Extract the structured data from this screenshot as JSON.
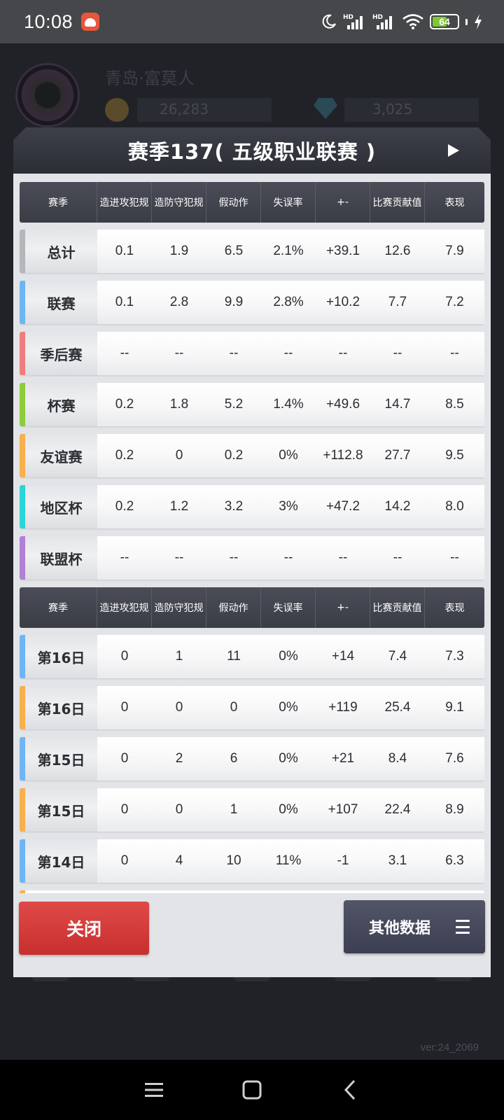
{
  "status_bar": {
    "time": "10:08",
    "battery": "64",
    "battery_level": 0.64,
    "icons": [
      "app-notification-icon",
      "moon-icon",
      "signal-hd-icon",
      "signal-hd-icon",
      "wifi-icon",
      "battery-icon",
      "charging-icon"
    ]
  },
  "background": {
    "username": "青岛·富莫人",
    "coins": "26,283",
    "gems": "3,025",
    "nav_labels": [
      "",
      "",
      "",
      "",
      ""
    ]
  },
  "modal": {
    "title": "赛季137( 五级职业联赛 )",
    "columns": [
      "赛季",
      "造进攻犯规",
      "造防守犯规",
      "假动作",
      "失误率",
      "+-",
      "比赛贡献值",
      "表现"
    ],
    "season_rows": [
      {
        "label": "总计",
        "accent": "#b5b6b9",
        "values": [
          "0.1",
          "1.9",
          "6.5",
          "2.1%",
          "+39.1",
          "12.6",
          "7.9"
        ]
      },
      {
        "label": "联赛",
        "accent": "#6fb4f5",
        "values": [
          "0.1",
          "2.8",
          "9.9",
          "2.8%",
          "+10.2",
          "7.7",
          "7.2"
        ]
      },
      {
        "label": "季后赛",
        "accent": "#f07d7d",
        "values": [
          "--",
          "--",
          "--",
          "--",
          "--",
          "--",
          "--"
        ]
      },
      {
        "label": "杯赛",
        "accent": "#8dcc3b",
        "values": [
          "0.2",
          "1.8",
          "5.2",
          "1.4%",
          "+49.6",
          "14.7",
          "8.5"
        ]
      },
      {
        "label": "友谊赛",
        "accent": "#f7b04e",
        "values": [
          "0.2",
          "0",
          "0.2",
          "0%",
          "+112.8",
          "27.7",
          "9.5"
        ]
      },
      {
        "label": "地区杯",
        "accent": "#2ad4d8",
        "values": [
          "0.2",
          "1.2",
          "3.2",
          "3%",
          "+47.2",
          "14.2",
          "8.0"
        ]
      },
      {
        "label": "联盟杯",
        "accent": "#b07fd6",
        "values": [
          "--",
          "--",
          "--",
          "--",
          "--",
          "--",
          "--"
        ]
      }
    ],
    "game_rows": [
      {
        "label": "第16日",
        "accent": "#6fb4f5",
        "values": [
          "0",
          "1",
          "11",
          "0%",
          "+14",
          "7.4",
          "7.3"
        ]
      },
      {
        "label": "第16日",
        "accent": "#f7b04e",
        "values": [
          "0",
          "0",
          "0",
          "0%",
          "+119",
          "25.4",
          "9.1"
        ]
      },
      {
        "label": "第15日",
        "accent": "#6fb4f5",
        "values": [
          "0",
          "2",
          "6",
          "0%",
          "+21",
          "8.4",
          "7.6"
        ]
      },
      {
        "label": "第15日",
        "accent": "#f7b04e",
        "values": [
          "0",
          "0",
          "1",
          "0%",
          "+107",
          "22.4",
          "8.9"
        ]
      },
      {
        "label": "第14日",
        "accent": "#6fb4f5",
        "values": [
          "0",
          "4",
          "10",
          "11%",
          "-1",
          "3.1",
          "6.3"
        ]
      }
    ],
    "close_label": "关闭",
    "other_data_label": "其他数据"
  },
  "version": "ver:24_2069"
}
